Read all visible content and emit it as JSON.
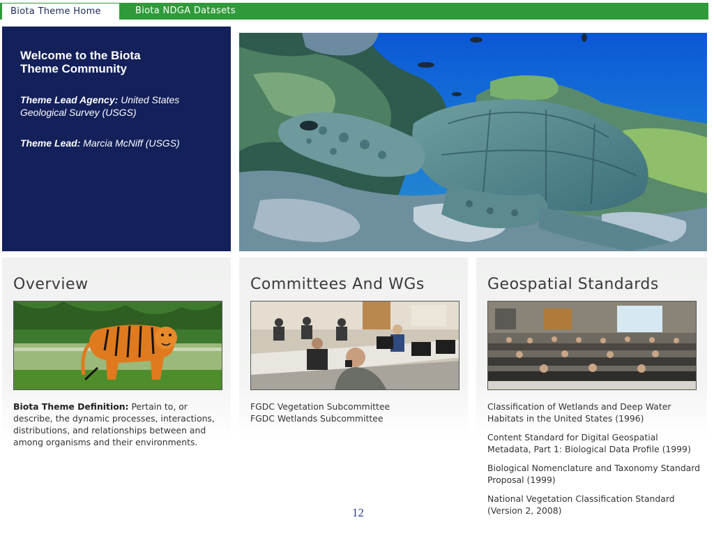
{
  "nav": {
    "tabs": [
      {
        "label": "Biota Theme Home",
        "active": true
      },
      {
        "label": "Biota NDGA Datasets",
        "active": false
      }
    ]
  },
  "welcome": {
    "title": "Welcome to the Biota Theme Community",
    "lead_agency_label": "Theme Lead Agency:",
    "lead_agency_value": "United States Geological Survey (USGS)",
    "lead_label": "Theme Lead:",
    "lead_value": "Marcia McNiff (USGS)"
  },
  "columns": {
    "overview": {
      "heading": "Overview",
      "definition_label": "Biota Theme Definition:",
      "definition_text": "Pertain to, or describe, the dynamic processes, interactions, distributions, and relationships between and among organisms and their environments."
    },
    "committees": {
      "heading": "Committees And WGs",
      "links": [
        "FGDC Vegetation Subcommittee",
        "FGDC Wetlands Subcommittee"
      ]
    },
    "standards": {
      "heading": "Geospatial Standards",
      "links": [
        "Classification of Wetlands and Deep Water Habitats in the United States (1996)",
        "Content Standard for Digital Geospatial Metadata, Part 1: Biological Data Profile (1999)",
        "Biological Nomenclature and Taxonomy Standard Proposal (1999)",
        "National Vegetation Classification Standard (Version 2, 2008)"
      ]
    }
  },
  "page_number": "12",
  "colors": {
    "nav_green": "#2f9a3a",
    "welcome_navy": "#13205a",
    "page_number_blue": "#2b3f8c"
  }
}
